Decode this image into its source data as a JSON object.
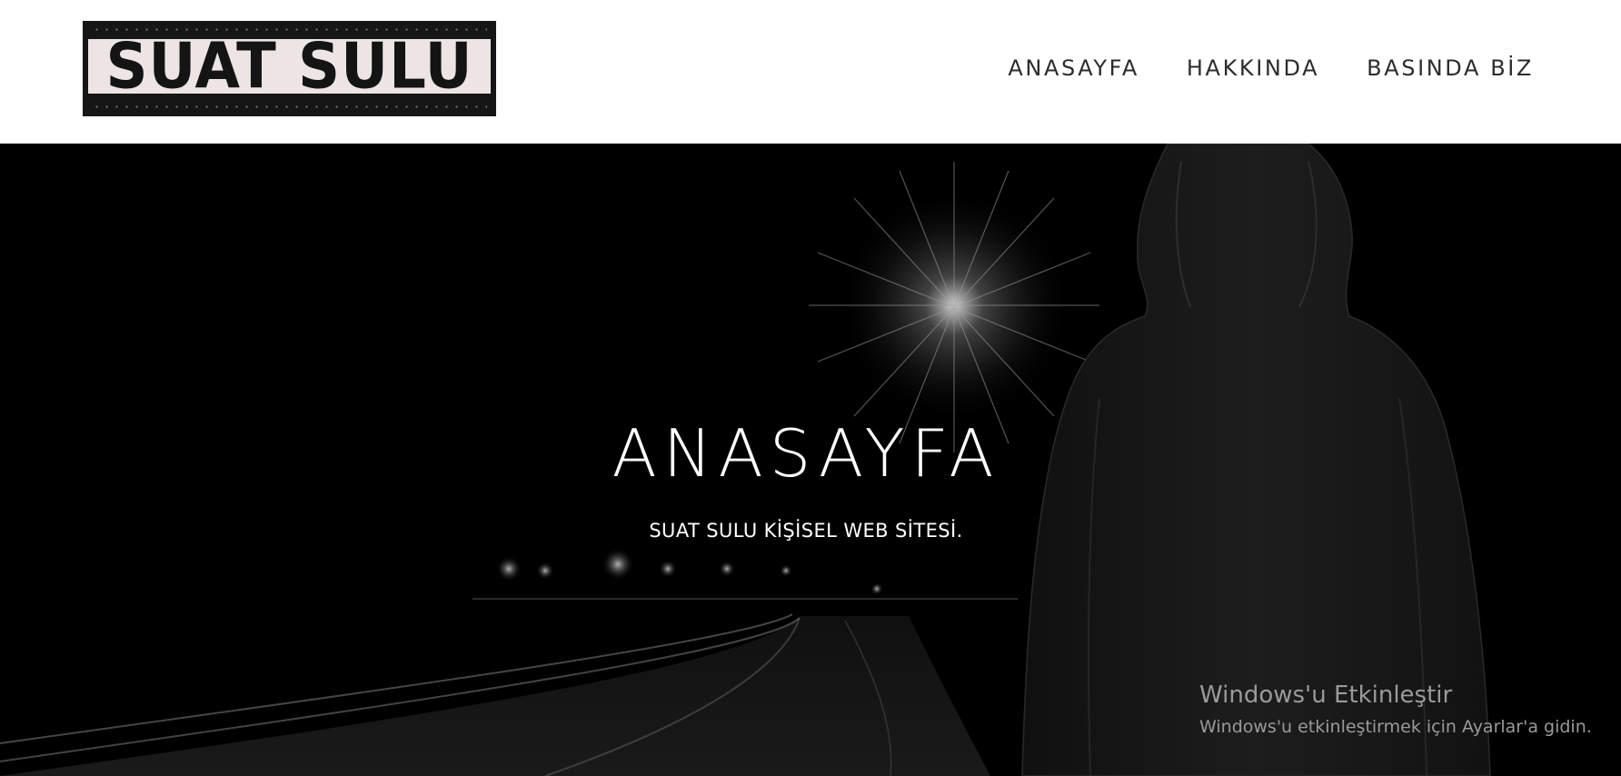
{
  "header": {
    "logo_text": "SUAT SULU"
  },
  "nav": {
    "items": [
      {
        "label": "ANASAYFA"
      },
      {
        "label": "HAKKINDA"
      },
      {
        "label": "BASINDA BİZ"
      }
    ]
  },
  "hero": {
    "title": "ANASAYFA",
    "subtitle": "SUAT SULU KİŞİSEL WEB SİTESİ."
  },
  "windows_activation": {
    "title": "Windows'u Etkinleştir",
    "text": "Windows'u etkinleştirmek için Ayarlar'a gidin."
  },
  "colors": {
    "hero_background": "#000000",
    "header_background": "#ffffff",
    "nav_text": "#2c2c2c",
    "logo_background": "#161616",
    "logo_plate": "#ece5e4"
  }
}
